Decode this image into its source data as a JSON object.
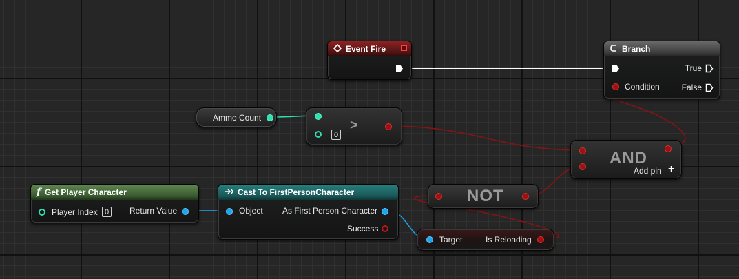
{
  "colors": {
    "exec": "#ffffff",
    "bool": "#a10f0f",
    "int": "#2ee0b0",
    "object": "#1ca6f0"
  },
  "nodes": {
    "event_fire": {
      "title": "Event Fire",
      "icon": "event-diamond-icon"
    },
    "branch": {
      "title": "Branch",
      "icon": "branch-icon",
      "condition": "Condition",
      "true_label": "True",
      "false_label": "False"
    },
    "ammo_count": {
      "label": "Ammo Count"
    },
    "greater": {
      "operator": ">",
      "default_value": "0"
    },
    "and_node": {
      "label": "AND",
      "add_pin": "Add pin",
      "add_icon": "plus-icon"
    },
    "not_node": {
      "label": "NOT"
    },
    "get_player": {
      "title": "Get Player Character",
      "icon": "function-icon",
      "icon_glyph": "f",
      "player_index": "Player Index",
      "player_index_value": "0",
      "return_value": "Return Value"
    },
    "cast": {
      "title": "Cast To FirstPersonCharacter",
      "icon": "cast-arrow-icon",
      "object": "Object",
      "as_char": "As First Person Character",
      "success": "Success"
    },
    "is_reloading": {
      "target": "Target",
      "label": "Is Reloading"
    }
  }
}
